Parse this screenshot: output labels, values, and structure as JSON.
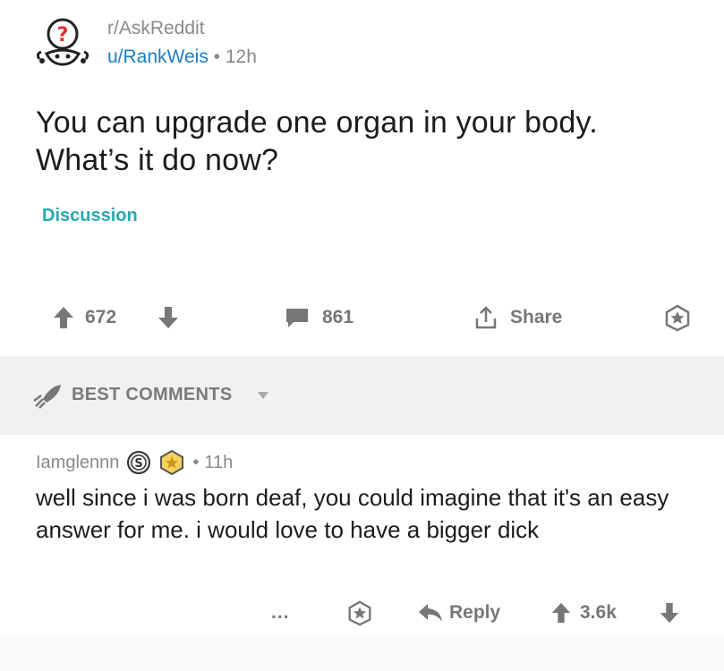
{
  "post": {
    "subreddit": "r/AskReddit",
    "author": "u/RankWeis",
    "dot": "•",
    "age": "12h",
    "title": "You can upgrade one organ in your body. What’s it do now?",
    "flair": "Discussion",
    "flair_color": "#2aa8b0",
    "votes": "672",
    "comments": "861",
    "share_label": "Share"
  },
  "best_comments": {
    "label": "BEST COMMENTS"
  },
  "comment": {
    "author": "Iamglennn",
    "badge_letter": "S",
    "dot": "•",
    "age": "11h",
    "body": "well since i was born deaf, you could imagine that it's an easy answer for me. i would love to have a bigger dick",
    "more_label": "...",
    "reply_label": "Reply",
    "score": "3.6k"
  },
  "colors": {
    "link_blue": "#1a7fc1",
    "muted_gray": "#777777",
    "section_bg": "#f1f1f1"
  },
  "icons": [
    "reddit-snoo-question-avatar",
    "upvote-arrow-icon",
    "downvote-arrow-icon",
    "comment-bubble-icon",
    "share-icon",
    "save-star-icon",
    "rocket-icon",
    "caret-down-icon",
    "silver-award-icon",
    "gold-award-icon",
    "reply-arrow-icon"
  ]
}
